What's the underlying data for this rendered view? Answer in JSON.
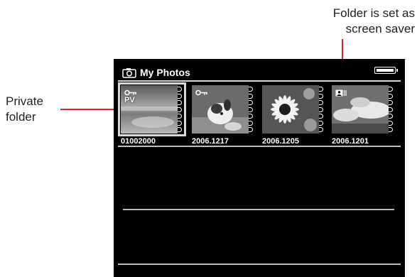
{
  "callouts": {
    "private": [
      "Private",
      "folder"
    ],
    "saver": [
      "Folder is set as",
      "screen saver"
    ]
  },
  "screen": {
    "title": "My Photos",
    "icons": {
      "title_icon": "camera-icon",
      "status_icon": "battery-icon"
    },
    "albums": [
      {
        "label": "01002000",
        "private": true,
        "private_text": "PV",
        "selected": true,
        "thumb": "beach"
      },
      {
        "label": "2006.1217",
        "private": false,
        "thumb": "dog"
      },
      {
        "label": "2006.1205",
        "private": false,
        "thumb": "flower"
      },
      {
        "label": "2006.1201",
        "private": false,
        "screen_saver": true,
        "thumb": "sky"
      }
    ]
  },
  "colors": {
    "callout_line": "#e1222c",
    "screen_bg": "#000000",
    "text": "#ffffff"
  }
}
